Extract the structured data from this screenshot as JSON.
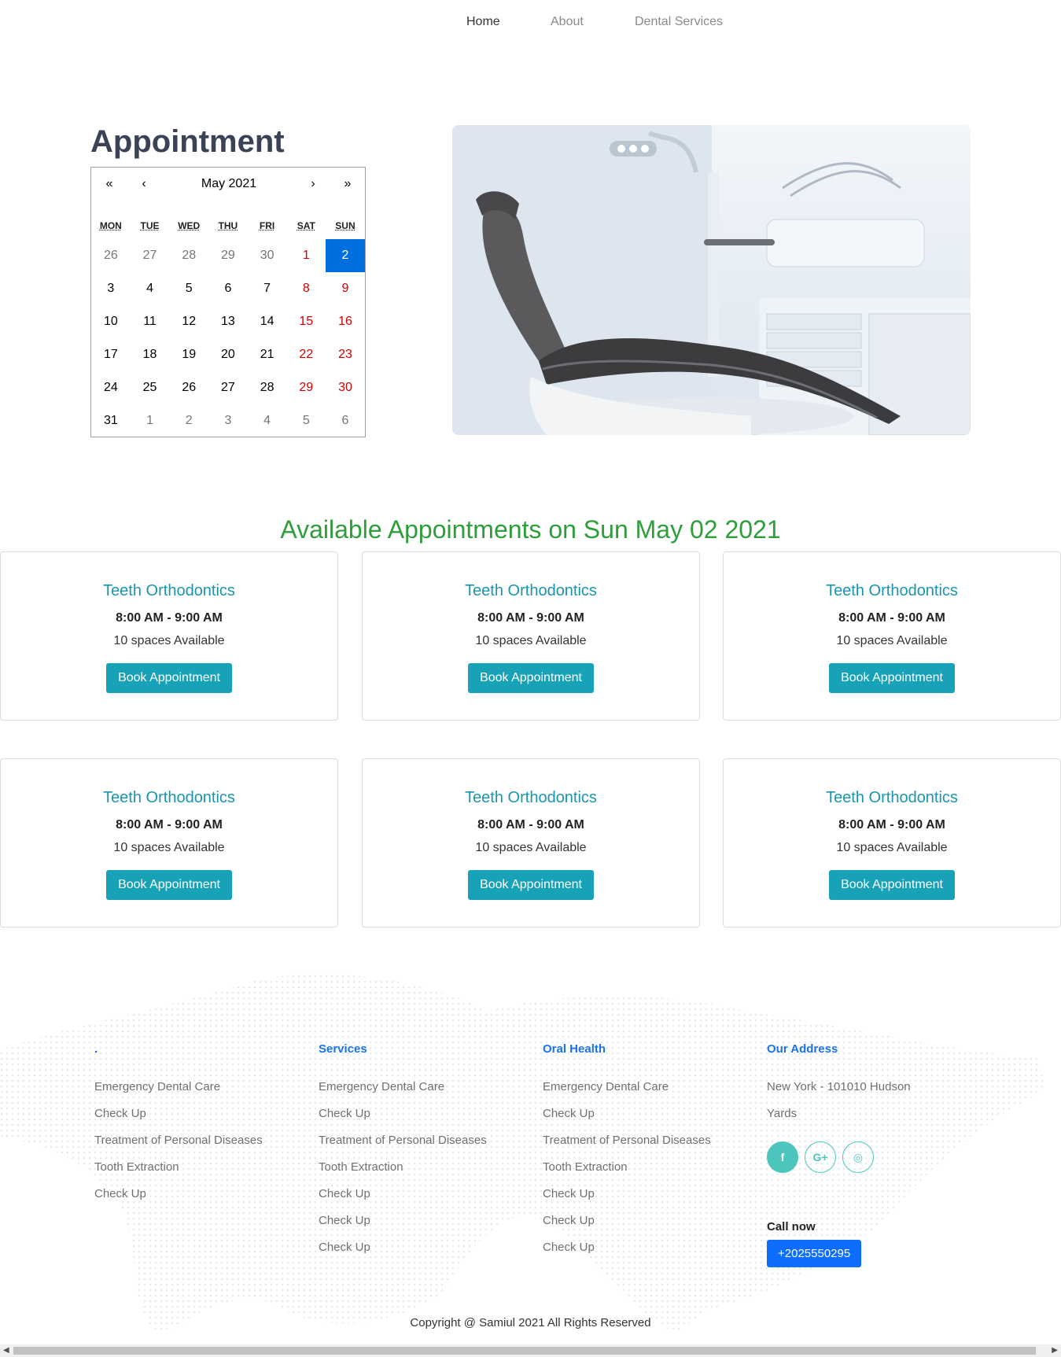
{
  "nav": {
    "items": [
      "Home",
      "About",
      "Dental Services"
    ]
  },
  "hero": {
    "title": "Appointment",
    "image_alt": "dental chair"
  },
  "calendar": {
    "prev_year": "«",
    "prev_month": "‹",
    "label": "May 2021",
    "next_month": "›",
    "next_year": "»",
    "weekdays": [
      "MON",
      "TUE",
      "WED",
      "THU",
      "FRI",
      "SAT",
      "SUN"
    ],
    "days": [
      {
        "d": "26",
        "t": "neighbor"
      },
      {
        "d": "27",
        "t": "neighbor"
      },
      {
        "d": "28",
        "t": "neighbor"
      },
      {
        "d": "29",
        "t": "neighbor"
      },
      {
        "d": "30",
        "t": "neighbor"
      },
      {
        "d": "1",
        "t": "weekend"
      },
      {
        "d": "2",
        "t": "selected"
      },
      {
        "d": "3",
        "t": ""
      },
      {
        "d": "4",
        "t": ""
      },
      {
        "d": "5",
        "t": ""
      },
      {
        "d": "6",
        "t": ""
      },
      {
        "d": "7",
        "t": ""
      },
      {
        "d": "8",
        "t": "weekend"
      },
      {
        "d": "9",
        "t": "weekend"
      },
      {
        "d": "10",
        "t": ""
      },
      {
        "d": "11",
        "t": ""
      },
      {
        "d": "12",
        "t": ""
      },
      {
        "d": "13",
        "t": ""
      },
      {
        "d": "14",
        "t": ""
      },
      {
        "d": "15",
        "t": "weekend"
      },
      {
        "d": "16",
        "t": "weekend"
      },
      {
        "d": "17",
        "t": ""
      },
      {
        "d": "18",
        "t": ""
      },
      {
        "d": "19",
        "t": ""
      },
      {
        "d": "20",
        "t": ""
      },
      {
        "d": "21",
        "t": ""
      },
      {
        "d": "22",
        "t": "weekend"
      },
      {
        "d": "23",
        "t": "weekend"
      },
      {
        "d": "24",
        "t": ""
      },
      {
        "d": "25",
        "t": ""
      },
      {
        "d": "26",
        "t": ""
      },
      {
        "d": "27",
        "t": ""
      },
      {
        "d": "28",
        "t": ""
      },
      {
        "d": "29",
        "t": "weekend"
      },
      {
        "d": "30",
        "t": "weekend"
      },
      {
        "d": "31",
        "t": ""
      },
      {
        "d": "1",
        "t": "neighbor"
      },
      {
        "d": "2",
        "t": "neighbor"
      },
      {
        "d": "3",
        "t": "neighbor"
      },
      {
        "d": "4",
        "t": "neighbor"
      },
      {
        "d": "5",
        "t": "neighbor"
      },
      {
        "d": "6",
        "t": "neighbor"
      }
    ]
  },
  "available": {
    "title": "Available Appointments on Sun May 02 2021",
    "cards": [
      {
        "title": "Teeth Orthodontics",
        "time": "8:00 AM - 9:00 AM",
        "spaces": "10 spaces Available",
        "button": "Book Appointment"
      },
      {
        "title": "Teeth Orthodontics",
        "time": "8:00 AM - 9:00 AM",
        "spaces": "10 spaces Available",
        "button": "Book Appointment"
      },
      {
        "title": "Teeth Orthodontics",
        "time": "8:00 AM - 9:00 AM",
        "spaces": "10 spaces Available",
        "button": "Book Appointment"
      },
      {
        "title": "Teeth Orthodontics",
        "time": "8:00 AM - 9:00 AM",
        "spaces": "10 spaces Available",
        "button": "Book Appointment"
      },
      {
        "title": "Teeth Orthodontics",
        "time": "8:00 AM - 9:00 AM",
        "spaces": "10 spaces Available",
        "button": "Book Appointment"
      },
      {
        "title": "Teeth Orthodontics",
        "time": "8:00 AM - 9:00 AM",
        "spaces": "10 spaces Available",
        "button": "Book Appointment"
      }
    ]
  },
  "footer": {
    "col1": {
      "title": ".",
      "items": [
        "Emergency Dental Care",
        "Check Up",
        "Treatment of Personal Diseases",
        "Tooth Extraction",
        "Check Up"
      ]
    },
    "col2": {
      "title": "Services",
      "items": [
        "Emergency Dental Care",
        "Check Up",
        "Treatment of Personal Diseases",
        "Tooth Extraction",
        "Check Up",
        "Check Up",
        "Check Up"
      ]
    },
    "col3": {
      "title": "Oral Health",
      "items": [
        "Emergency Dental Care",
        "Check Up",
        "Treatment of Personal Diseases",
        "Tooth Extraction",
        "Check Up",
        "Check Up",
        "Check Up"
      ]
    },
    "col4": {
      "title": "Our Address",
      "address_line1": "New York - 101010 Hudson",
      "address_line2": "Yards",
      "social": [
        {
          "icon": "facebook-icon",
          "glyph": "f"
        },
        {
          "icon": "google-plus-icon",
          "glyph": "G+"
        },
        {
          "icon": "instagram-icon",
          "glyph": "◎"
        }
      ],
      "call_label": "Call now",
      "phone": "+2025550295"
    },
    "copyright": "Copyright @ Samiul 2021 All Rights Reserved"
  },
  "colors": {
    "accent_teal": "#17a2b8",
    "heading_green": "#2e9e3a",
    "link_blue": "#1a73e8",
    "phone_blue": "#0d6efd",
    "calendar_selected": "#006edc",
    "weekend_red": "#d10000"
  }
}
